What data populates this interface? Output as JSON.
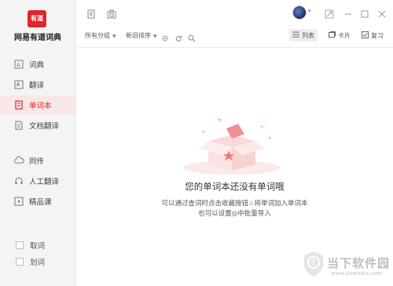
{
  "app": {
    "logo_text": "有道",
    "name": "网易有道词典"
  },
  "sidebar": {
    "items": [
      {
        "label": "词典",
        "icon": "dictionary-icon"
      },
      {
        "label": "翻译",
        "icon": "translate-icon"
      },
      {
        "label": "单词本",
        "icon": "wordbook-icon",
        "active": true
      },
      {
        "label": "文档翻译",
        "icon": "document-translate-icon"
      },
      {
        "label": "同传",
        "icon": "cloud-icon"
      },
      {
        "label": "人工翻译",
        "icon": "headset-icon"
      },
      {
        "label": "精品课",
        "icon": "play-course-icon"
      }
    ],
    "checks": [
      {
        "label": "取词"
      },
      {
        "label": "划词"
      }
    ]
  },
  "toolbar": {
    "group_label": "所有分组",
    "sort_label": "新旧排序",
    "list_label": "列表",
    "card_label": "卡片",
    "review_label": "复习"
  },
  "empty": {
    "title": "您的单词本还没有单词哦",
    "line1": "可以通过查词时点击收藏按钮☆将单词加入单词本",
    "line2": "也可以设置◎中批量导入"
  },
  "watermark": {
    "text": "当下软件园",
    "url": "www.downxia.com"
  },
  "colors": {
    "accent": "#e0262d",
    "active_bg": "#f9e7e7",
    "sidebar_bg": "#f4f4f4"
  }
}
